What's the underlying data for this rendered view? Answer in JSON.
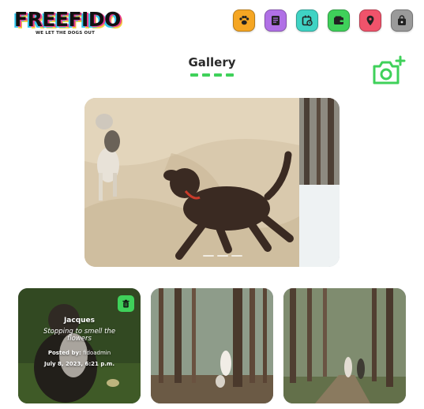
{
  "brand": {
    "name": "FREEFIDO",
    "tagline": "WE LET THE DOGS OUT"
  },
  "nav": [
    {
      "name": "paw-icon",
      "color": "#f5a623"
    },
    {
      "name": "newspaper-icon",
      "color": "#b070e6"
    },
    {
      "name": "calendar-icon",
      "color": "#3fd3c4"
    },
    {
      "name": "wallet-icon",
      "color": "#3fd15a"
    },
    {
      "name": "location-pin-icon",
      "color": "#f0536b"
    },
    {
      "name": "shopping-bag-icon",
      "color": "#9a9a9a"
    }
  ],
  "page": {
    "title": "Gallery"
  },
  "accent": "#3fd15a",
  "gallery": {
    "cards": [
      {
        "name": "Jacques",
        "caption": "Stopping to smell the flowers",
        "posted_label": "Posted by:",
        "posted_by": "fidoadmin",
        "date": "July 8, 2023, 6:21 p.m.",
        "deletable": true
      },
      {},
      {}
    ]
  }
}
